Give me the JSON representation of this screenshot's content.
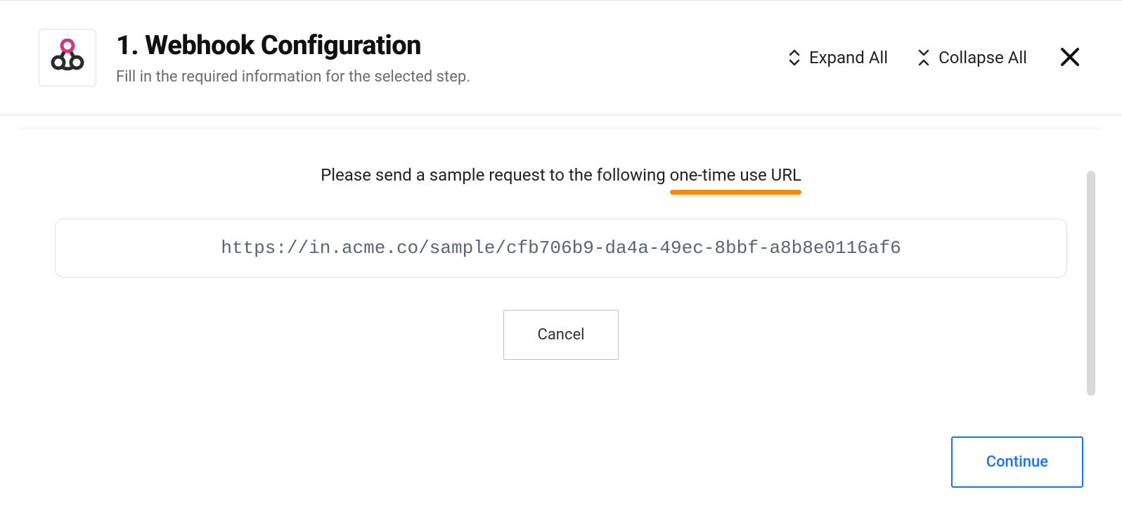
{
  "header": {
    "title": "1. Webhook Configuration",
    "subtitle": "Fill in the required information for the selected step.",
    "expand_label": "Expand All",
    "collapse_label": "Collapse All",
    "icon": "webhook-icon"
  },
  "main": {
    "instruction": "Please send a sample request to the following one-time use URL",
    "underline_target": "one-time use URL",
    "url": "https://in.acme.co/sample/cfb706b9-da4a-49ec-8bbf-a8b8e0116af6",
    "cancel_label": "Cancel"
  },
  "footer": {
    "continue_label": "Continue"
  }
}
